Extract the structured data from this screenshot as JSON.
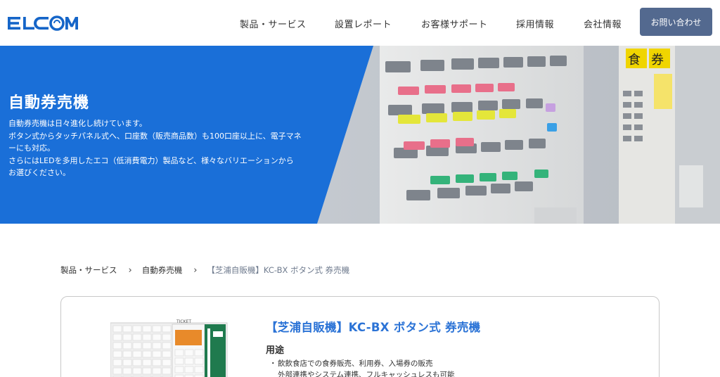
{
  "header": {
    "logo_text": "ELCOM",
    "nav": [
      {
        "label": "製品・サービス"
      },
      {
        "label": "設置レポート"
      },
      {
        "label": "お客様サポート"
      },
      {
        "label": "採用情報"
      },
      {
        "label": "会社情報"
      }
    ],
    "contact_label": "お問い合わせ"
  },
  "hero": {
    "title": "自動券売機",
    "lines": [
      "自動券売機は日々進化し続けています。",
      "ボタン式からタッチパネル式へ、口座数（販売商品数）も100口座以上に、電子マネ",
      "ーにも対応。",
      "さらにはLEDを多用したエコ（低消費電力）製品など、様々なバリエーションから",
      "お選びください。"
    ]
  },
  "breadcrumb": {
    "items": [
      "製品・サービス",
      "自動券売機"
    ],
    "current": "【芝浦自販機】KC-BX ボタン式 券売機"
  },
  "product": {
    "title": "【芝浦自販機】KC-BX ボタン式 券売機",
    "usage_heading": "用途",
    "usage_items": [
      {
        "text": "飲飲食店での食券販売、利用券、入場券の販売",
        "continuation": "外部連携やシステム連携、フルキャッシュレスも可能"
      }
    ],
    "bullet": "・"
  },
  "colors": {
    "brand_blue": "#1a6fd8",
    "nav_contact_bg": "#53698f",
    "title_blue": "#2b73d6"
  }
}
